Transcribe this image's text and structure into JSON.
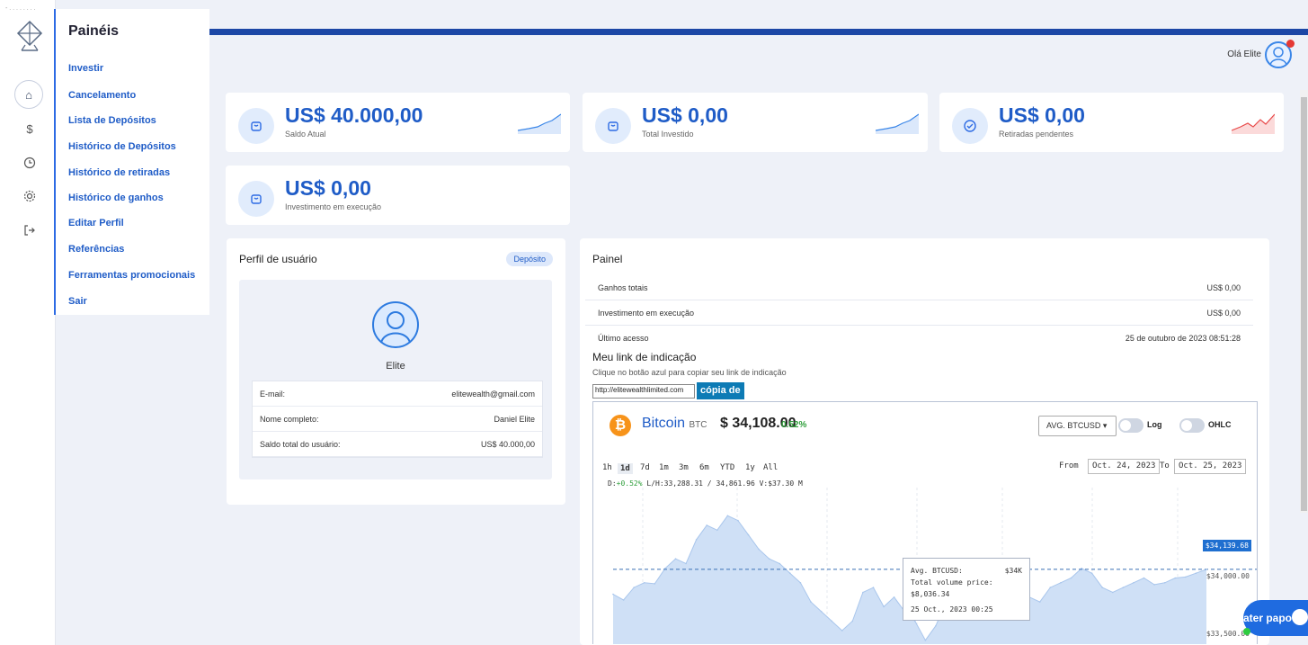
{
  "corner_text": "- . . .   . .   . . .",
  "menu": {
    "title": "Painéis",
    "items": [
      "Investir",
      "Cancelamento",
      "Lista de Depósitos",
      "Histórico de Depósitos",
      "Histórico de retiradas",
      "Histórico de ganhos",
      "Editar Perfil",
      "Referências",
      "Ferramentas promocionais",
      "Sair"
    ]
  },
  "rail_icons": [
    "home-icon",
    "dollar-icon",
    "clock-icon",
    "gear-icon",
    "logout-icon"
  ],
  "header": {
    "greeting": "Olá Elite"
  },
  "stats": [
    {
      "amount": "US$ 40.000,00",
      "label": "Saldo Atual",
      "trend": "up",
      "color": "#3a86e8"
    },
    {
      "amount": "US$ 0,00",
      "label": "Total Investido",
      "trend": "up",
      "color": "#3a86e8"
    },
    {
      "amount": "US$ 0,00",
      "label": "Retiradas pendentes",
      "trend": "up",
      "color": "#e84a4a"
    },
    {
      "amount": "US$ 0,00",
      "label": "Investimento em execução",
      "trend": "none",
      "color": "#3a86e8"
    }
  ],
  "profile": {
    "title": "Perfil de usuário",
    "badge": "Depósito",
    "name": "Elite",
    "rows": [
      {
        "label": "E-mail:",
        "value": "elitewealth@gmail.com"
      },
      {
        "label": "Nome completo:",
        "value": "Daniel Elite"
      },
      {
        "label": "Saldo total do usuário:",
        "value": "US$ 40.000,00"
      }
    ]
  },
  "panel": {
    "title": "Painel",
    "rows": [
      {
        "label": "Ganhos totais",
        "value": "US$ 0,00"
      },
      {
        "label": "Investimento em execução",
        "value": "US$ 0,00"
      },
      {
        "label": "Último acesso",
        "value": "25 de outubro de 2023 08:51:28"
      }
    ],
    "referral_title": "Meu link de indicação",
    "referral_hint": "Clique no botão azul para copiar seu link de indicação",
    "referral_link": "http://elitewealthlimited.com",
    "copy_label": "cópia de"
  },
  "btc_widget": {
    "name": "Bitcoin",
    "ticker": "BTC",
    "price": "$ 34,108.00",
    "change": "0.52%",
    "select_label": "AVG. BTCUSD ▾",
    "toggle_log": "Log",
    "toggle_ohlc": "OHLC",
    "ranges": [
      "1h",
      "1d",
      "7d",
      "1m",
      "3m",
      "6m",
      "YTD",
      "1y",
      "All"
    ],
    "active_range": "1d",
    "from_label": "From",
    "from_date": "Oct. 24, 2023",
    "to_label": "To",
    "to_date": "Oct. 25, 2023",
    "stats_d": "D:",
    "stats_d_val": "+0.52%",
    "stats_rest": "L/H:33,288.31 / 34,861.96 V:$37.30 M",
    "tooltip_avg_label": "Avg. BTCUSD:",
    "tooltip_avg_value": "$34K",
    "tooltip_volume": "Total volume price: $8,036.34",
    "tooltip_time": "25 Oct., 2023 00:25",
    "price_tag": "$34,139.68",
    "y_labels": [
      "$34,000.00",
      "$33,500.00"
    ]
  },
  "chat": {
    "label": "ater papo"
  },
  "chart_data": {
    "type": "area",
    "title": "Bitcoin BTC",
    "x": [
      "Oct. 24, 2023",
      "Oct. 25, 2023"
    ],
    "y_ticks": [
      34000.0,
      33500.0
    ],
    "series": [
      {
        "name": "AVG. BTCUSD",
        "values": [
          33880,
          33820,
          33950,
          34000,
          33990,
          34150,
          34250,
          34200,
          34450,
          34600,
          34550,
          34700,
          34650,
          34500,
          34350,
          34250,
          34200,
          34100,
          34000,
          33800,
          33700,
          33600,
          33500,
          33600,
          33900,
          33950,
          33750,
          33850,
          33700,
          33600,
          33400,
          33550,
          33800,
          33900,
          33950,
          34000,
          33900,
          33850,
          33950,
          33900,
          33850,
          33800,
          33950,
          34000,
          34050,
          34150,
          34100,
          33950,
          33900,
          33950,
          34000,
          34050,
          33980,
          34000,
          34050,
          34060,
          34100,
          34139.68
        ]
      }
    ],
    "legend_position": "none",
    "grid": false
  }
}
